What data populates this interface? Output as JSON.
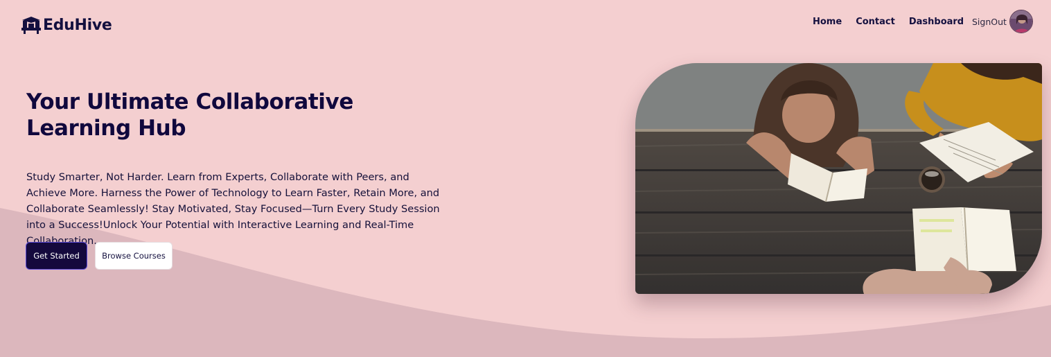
{
  "brand": {
    "name": "EduHive"
  },
  "nav": {
    "links": [
      "Home",
      "Contact",
      "Dashboard"
    ],
    "signout_label": "SignOut"
  },
  "hero": {
    "title": "Your Ultimate Collaborative Learning Hub",
    "description": "Study Smarter, Not Harder. Learn from Experts, Collaborate with Peers, and Achieve More. Harness the Power of Technology to Learn Faster, Retain More, and Collaborate Seamlessly! Stay Motivated, Stay Focused—Turn Every Study Session into a Success!Unlock Your Potential with Interactive Learning and Real-Time Collaboration.",
    "primary_button": "Get Started",
    "secondary_button": "Browse Courses"
  },
  "colors": {
    "background": "#f4cfd0",
    "wave": "#dcb7bd",
    "primary": "#14093d",
    "text": "#14103f"
  },
  "icons": {
    "logo": "graduation-books-icon",
    "avatar": "user-avatar"
  }
}
